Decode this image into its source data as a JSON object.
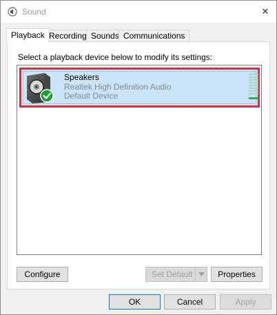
{
  "window": {
    "title": "Sound",
    "close_glyph": "✕"
  },
  "tabs": [
    {
      "label": "Playback",
      "active": true
    },
    {
      "label": "Recording",
      "active": false
    },
    {
      "label": "Sounds",
      "active": false
    },
    {
      "label": "Communications",
      "active": false
    }
  ],
  "playback": {
    "instruction": "Select a playback device below to modify its settings:",
    "devices": [
      {
        "name": "Speakers",
        "description": "Realtek High Definition Audio",
        "status": "Default Device",
        "icon": "speaker-icon",
        "badge": "check-badge-icon",
        "selected": true,
        "level_fraction": 0.1
      }
    ],
    "buttons": {
      "configure": "Configure",
      "set_default": "Set Default",
      "properties": "Properties"
    }
  },
  "footer": {
    "ok": "OK",
    "cancel": "Cancel",
    "apply": "Apply"
  },
  "colors": {
    "selection": "#cce4f7",
    "highlight_border": "#d0333c",
    "badge_green": "#1a9e3a",
    "accent": "#0078d7"
  }
}
